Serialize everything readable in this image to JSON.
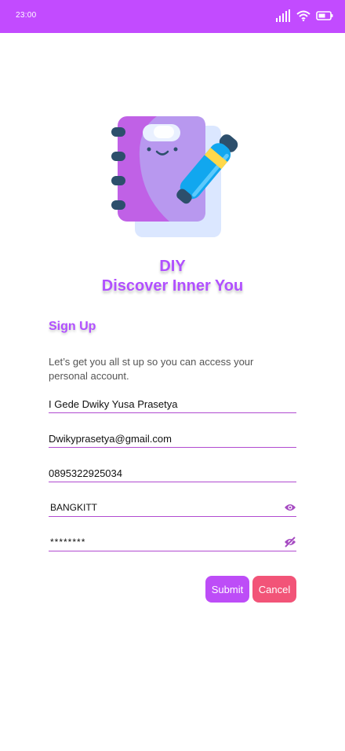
{
  "status_bar": {
    "time": "23:00",
    "icons": [
      "signal-icon",
      "wifi-icon",
      "battery-icon"
    ],
    "color": "#c24bff"
  },
  "header": {
    "title_line1": "DIY",
    "title_line2": "Discover Inner You",
    "illustration": "notebook-pen-illustration"
  },
  "signup": {
    "heading": "Sign Up",
    "description": "Let’s get you all st up so you can access your personal account."
  },
  "form": {
    "full_name": "I Gede Dwiky Yusa Prasetya",
    "email": "Dwikyprasetya@gmail.com",
    "phone": "0895322925034",
    "password": "BANGKITT",
    "confirm_password": "********",
    "password_toggle_icon": "eye-icon",
    "confirm_toggle_icon": "eye-off-icon"
  },
  "buttons": {
    "submit": "Submit",
    "cancel": "Cancel"
  },
  "colors": {
    "accent": "#b150ff",
    "submit": "#bd4df7",
    "cancel": "#f25478",
    "underline": "#b14bd0"
  }
}
